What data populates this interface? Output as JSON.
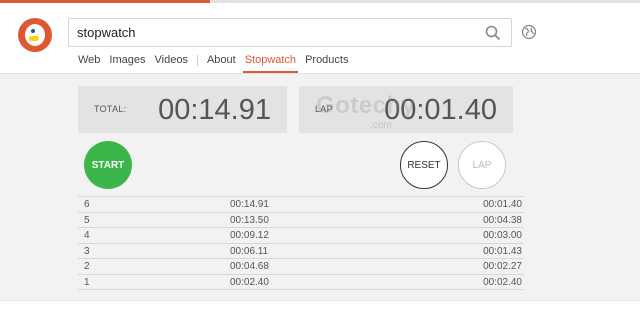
{
  "search": {
    "value": "stopwatch",
    "placeholder": ""
  },
  "nav": {
    "items": [
      {
        "label": "Web"
      },
      {
        "label": "Images"
      },
      {
        "label": "Videos"
      },
      {
        "label": "About"
      },
      {
        "label": "Stopwatch"
      },
      {
        "label": "Products"
      }
    ],
    "active": "Stopwatch"
  },
  "stopwatch": {
    "total_label": "TOTAL:",
    "total_time": "00:14.91",
    "lap_label": "LAP",
    "lap_time": "00:01.40",
    "start_label": "START",
    "reset_label": "RESET",
    "lap_button_label": "LAP"
  },
  "laps": [
    {
      "num": "6",
      "total": "00:14.91",
      "split": "00:01.40"
    },
    {
      "num": "5",
      "total": "00:13.50",
      "split": "00:04.38"
    },
    {
      "num": "4",
      "total": "00:09.12",
      "split": "00:03.00"
    },
    {
      "num": "3",
      "total": "00:06.11",
      "split": "00:01.43"
    },
    {
      "num": "2",
      "total": "00:04.68",
      "split": "00:02.27"
    },
    {
      "num": "1",
      "total": "00:02.40",
      "split": "00:02.40"
    }
  ],
  "watermark": {
    "text": "Gotechy",
    "sub": ".com"
  },
  "colors": {
    "accent": "#de5833",
    "start": "#3cb54a",
    "main_bg": "#f2f2f2",
    "panel_bg": "#e3e3e3"
  }
}
